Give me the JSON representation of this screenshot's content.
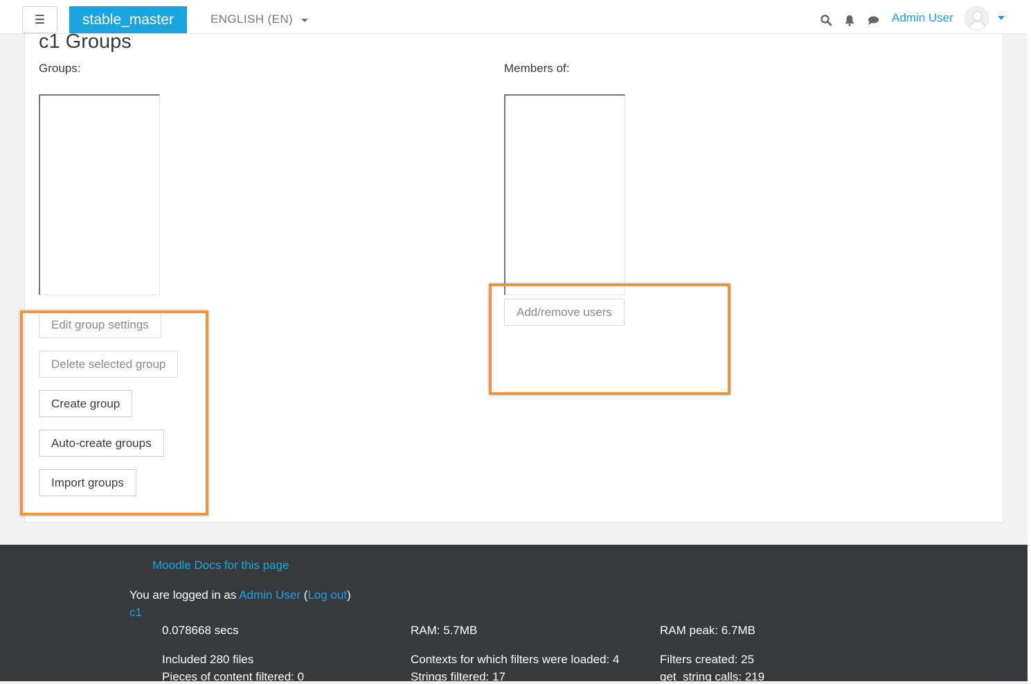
{
  "navbar": {
    "menu_icon": "hamburger-icon",
    "menu_glyph": "☰",
    "brand": "stable_master",
    "language": "ENGLISH (EN)",
    "icons": [
      "search-icon",
      "bell-icon",
      "chat-icon"
    ],
    "user_name": "Admin User",
    "colors": {
      "brand": "#1ba3de",
      "link": "#1ba3de"
    }
  },
  "page": {
    "title": "c1 Groups",
    "groups_label": "Groups:",
    "members_label": "Members of:"
  },
  "group_buttons": {
    "edit_settings": "Edit group settings",
    "delete_selected": "Delete selected group",
    "create_group": "Create group",
    "auto_create": "Auto-create groups",
    "import_groups": "Import groups"
  },
  "member_buttons": {
    "add_remove_users": "Add/remove users"
  },
  "highlight_color": "#f0953a",
  "footer": {
    "docs_link": "Moodle Docs for this page",
    "logged_in_prefix": "You are logged in as ",
    "user_link": "Admin User",
    "open_paren": "(",
    "logout_link": "Log out",
    "close_paren": ")",
    "course_link": "c1",
    "stats": [
      [
        "0.078668 secs",
        "RAM: 5.7MB",
        "RAM peak: 6.7MB"
      ],
      [
        "Included 280 files",
        "Contexts for which filters were loaded: 4",
        "Filters created: 25"
      ],
      [
        "Pieces of content filtered: 0",
        "Strings filtered: 17",
        "get_string calls: 219"
      ]
    ],
    "background": "#373a3c"
  }
}
